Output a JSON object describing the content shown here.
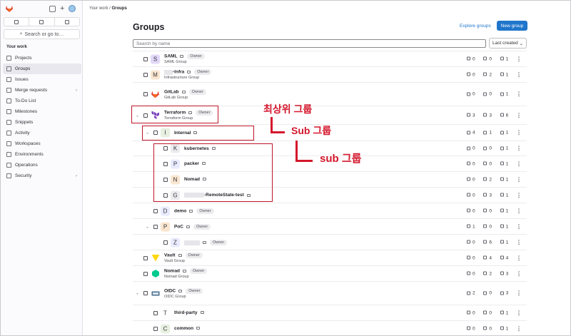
{
  "breadcrumb": {
    "parent": "Your work",
    "current": "Groups"
  },
  "sidebar": {
    "heading": "Your work",
    "search_label": "Search or go to…",
    "items": [
      {
        "label": "Projects",
        "icon": "project-icon"
      },
      {
        "label": "Groups",
        "icon": "group-icon",
        "active": true
      },
      {
        "label": "Issues",
        "icon": "issues-icon"
      },
      {
        "label": "Merge requests",
        "icon": "merge-request-icon",
        "chevron": "›"
      },
      {
        "label": "To-Do List",
        "icon": "todo-icon"
      },
      {
        "label": "Milestones",
        "icon": "milestone-icon"
      },
      {
        "label": "Snippets",
        "icon": "snippet-icon"
      },
      {
        "label": "Activity",
        "icon": "activity-icon"
      },
      {
        "label": "Workspaces",
        "icon": "workspace-icon"
      },
      {
        "label": "Environments",
        "icon": "environment-icon"
      },
      {
        "label": "Operations",
        "icon": "operations-icon"
      },
      {
        "label": "Security",
        "icon": "shield-icon",
        "chevron": "›"
      }
    ]
  },
  "page": {
    "title": "Groups",
    "explore_label": "Explore groups",
    "new_group_label": "New group",
    "search_placeholder": "Search by name",
    "sort_label": "Last created",
    "sort_chevron": "⌄"
  },
  "groups": [
    {
      "name": "SAML",
      "desc": "SAML Group",
      "badge": "Owner",
      "avatar": "S",
      "stats": [
        "0",
        "0",
        "1"
      ]
    },
    {
      "name": "-Infra",
      "desc": "Infrastructure Group",
      "badge": "Owner",
      "avatar": "M",
      "stats": [
        "0",
        "2",
        "1"
      ]
    },
    {
      "name": "GitLab",
      "desc": "GitLab Group",
      "badge": "Owner",
      "avatar": "",
      "stats": [
        "0",
        "0",
        "1"
      ]
    },
    {
      "name": "Terraform",
      "desc": "Terraform Group",
      "badge": "Owner",
      "avatar": "",
      "stats": [
        "3",
        "3",
        "6"
      ]
    },
    {
      "name": "Internal",
      "desc": "",
      "badge": "",
      "avatar": "I",
      "stats": [
        "4",
        "1",
        "1"
      ]
    },
    {
      "name": "kubernetes",
      "desc": "",
      "badge": "",
      "avatar": "K",
      "stats": [
        "0",
        "0",
        "1"
      ]
    },
    {
      "name": "packer",
      "desc": "",
      "badge": "",
      "avatar": "P",
      "stats": [
        "0",
        "0",
        "1"
      ]
    },
    {
      "name": "Nomad",
      "desc": "",
      "badge": "",
      "avatar": "N",
      "stats": [
        "0",
        "2",
        "1"
      ]
    },
    {
      "name": "-RemoteState-test",
      "desc": "",
      "badge": "",
      "avatar": "G",
      "stats": [
        "0",
        "3",
        "1"
      ]
    },
    {
      "name": "demo",
      "desc": "",
      "badge": "Owner",
      "avatar": "D",
      "stats": [
        "0",
        "0",
        "1"
      ]
    },
    {
      "name": "PoC",
      "desc": "",
      "badge": "Owner",
      "avatar": "P",
      "stats": [
        "1",
        "0",
        "1"
      ]
    },
    {
      "name": "",
      "desc": "",
      "badge": "Owner",
      "avatar": "Z",
      "stats": [
        "0",
        "6",
        "1"
      ]
    },
    {
      "name": "Vault",
      "desc": "Vault Group",
      "badge": "Owner",
      "avatar": "",
      "stats": [
        "0",
        "4",
        "4"
      ]
    },
    {
      "name": "Nomad",
      "desc": "Nomad Group",
      "badge": "Owner",
      "avatar": "",
      "stats": [
        "0",
        "2",
        "3"
      ]
    },
    {
      "name": "OIDC",
      "desc": "OIDC Group",
      "badge": "Owner",
      "avatar": "",
      "stats": [
        "2",
        "0",
        "3"
      ]
    },
    {
      "name": "third-party",
      "desc": "",
      "badge": "",
      "avatar": "T",
      "stats": [
        "0",
        "0",
        "1"
      ]
    },
    {
      "name": "common",
      "desc": "",
      "badge": "",
      "avatar": "C",
      "stats": [
        "0",
        "0",
        "1"
      ]
    }
  ],
  "annotations": {
    "top": "최상위 그룹",
    "sub1": "Sub 그룹",
    "sub2": "sub 그룹"
  },
  "colors": {
    "accent": "#1f75cb",
    "annotation": "#d4172c",
    "terraform": "#7b42bc",
    "vault": "#ffd814",
    "nomad": "#00ca8e",
    "gitlab": "#e24329"
  }
}
